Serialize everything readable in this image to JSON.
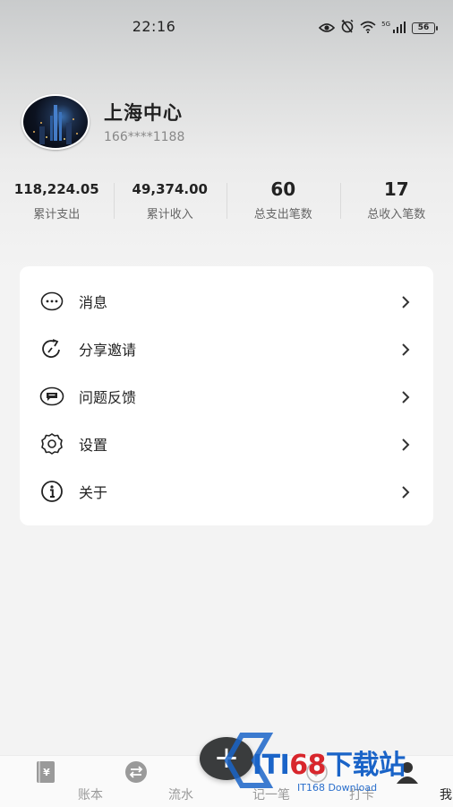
{
  "status_bar": {
    "time": "22:16",
    "network": "5G",
    "battery": "56"
  },
  "profile": {
    "name": "上海中心",
    "phone": "166****1188"
  },
  "stats": [
    {
      "value": "118,224.05",
      "label": "累计支出"
    },
    {
      "value": "49,374.00",
      "label": "累计收入"
    },
    {
      "value": "60",
      "label": "总支出笔数"
    },
    {
      "value": "17",
      "label": "总收入笔数"
    }
  ],
  "menu": {
    "items": [
      {
        "label": "消息",
        "icon": "message-dots-icon"
      },
      {
        "label": "分享邀请",
        "icon": "share-refresh-icon"
      },
      {
        "label": "问题反馈",
        "icon": "feedback-bubble-icon"
      },
      {
        "label": "设置",
        "icon": "gear-icon"
      },
      {
        "label": "关于",
        "icon": "info-icon"
      }
    ]
  },
  "fab": {
    "symbol": "+"
  },
  "bottom_nav": {
    "items": [
      {
        "label": "账本",
        "icon": "ledger-book-icon"
      },
      {
        "label": "流水",
        "icon": "transfer-arrows-icon"
      },
      {
        "label": "记一笔",
        "icon": "add-record-icon"
      },
      {
        "label": "打卡",
        "icon": "checkin-icon"
      },
      {
        "label": "我的",
        "icon": "profile-icon",
        "active": true
      }
    ]
  },
  "watermark": {
    "prefix": "ITI",
    "number": "68",
    "suffix": "下载站",
    "sub": "IT168 Download"
  },
  "colors": {
    "accent_dark": "#3a3c3d",
    "watermark_blue": "#1a64c8",
    "watermark_red": "#d8262c"
  }
}
